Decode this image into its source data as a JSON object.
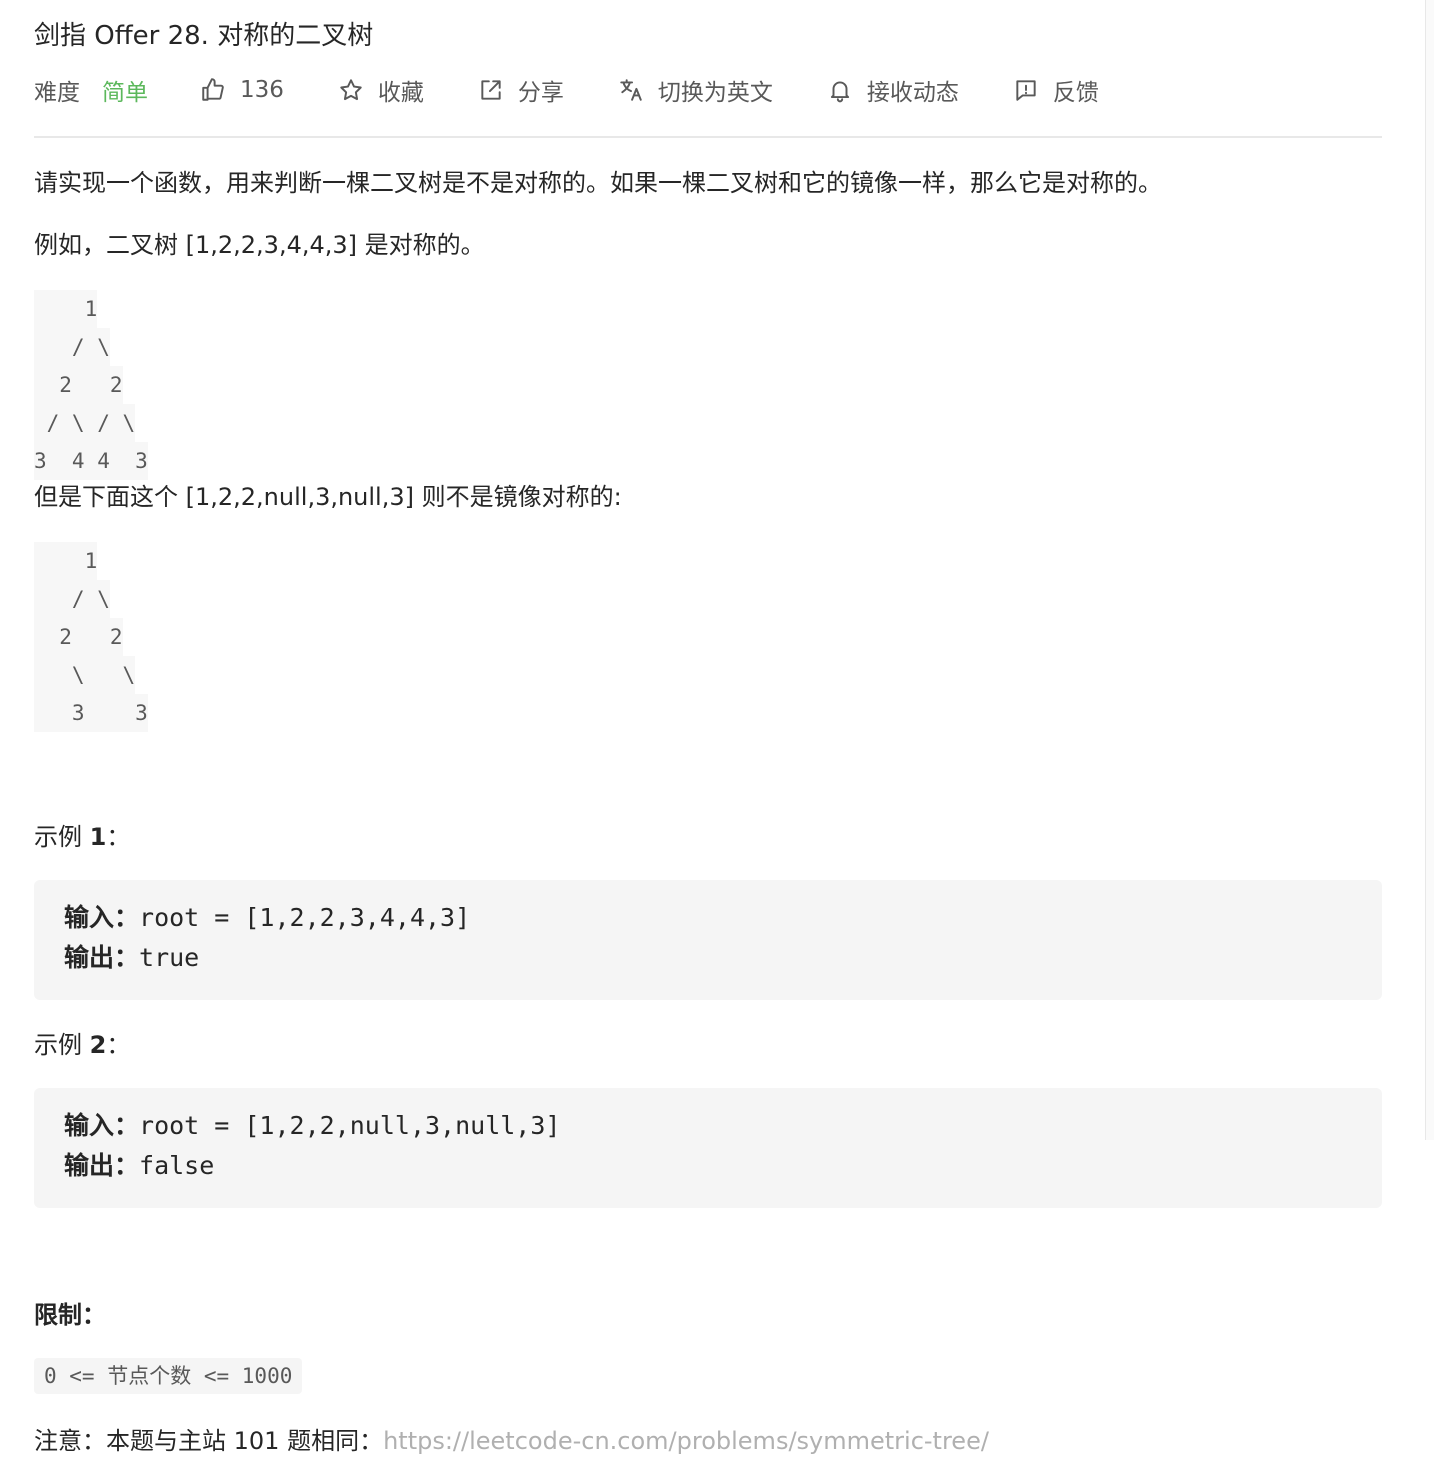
{
  "problem": {
    "title": "剑指 Offer 28. 对称的二叉树",
    "difficulty_label": "难度",
    "difficulty_value": "简单",
    "likes": "136",
    "favorite_label": "收藏",
    "share_label": "分享",
    "switch_lang_label": "切换为英文",
    "subscribe_label": "接收动态",
    "feedback_label": "反馈"
  },
  "description": {
    "intro": "请实现一个函数，用来判断一棵二叉树是不是对称的。如果一棵二叉树和它的镜像一样，那么它是对称的。",
    "example_sentence": "例如，二叉树 [1,2,2,3,4,4,3] 是对称的。",
    "tree1": [
      "    1",
      "   / \\",
      "  2   2",
      " / \\ / \\",
      "3  4 4  3"
    ],
    "counter_sentence": "但是下面这个 [1,2,2,null,3,null,3] 则不是镜像对称的:",
    "tree2": [
      "    1",
      "   / \\",
      "  2   2",
      "   \\   \\",
      "   3    3"
    ]
  },
  "examples": [
    {
      "heading_prefix": "示例 ",
      "heading_num": "1",
      "heading_suffix": "：",
      "input_label": "输入：",
      "input": "root = [1,2,2,3,4,4,3]",
      "output_label": "输出：",
      "output": "true"
    },
    {
      "heading_prefix": "示例 ",
      "heading_num": "2",
      "heading_suffix": "：",
      "input_label": "输入：",
      "input": "root = [1,2,2,null,3,null,3]",
      "output_label": "输出：",
      "output": "false"
    }
  ],
  "constraints": {
    "heading": "限制：",
    "text": "0 <= 节点个数 <= 1000"
  },
  "note": {
    "text": "注意：本题与主站 101 题相同：",
    "link": "https://leetcode-cn.com/problems/symmetric-tree/"
  },
  "colors": {
    "easy": "#5cb85c",
    "code_bg": "#f5f5f5",
    "link": "#b0b0b0"
  },
  "icons": [
    "thumbs-up-icon",
    "star-icon",
    "share-icon",
    "translate-icon",
    "bell-icon",
    "feedback-icon"
  ]
}
